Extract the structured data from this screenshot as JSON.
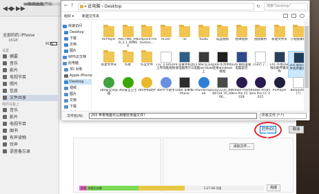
{
  "itunes": {
    "window_title": "单击此处开始",
    "device_name": "全部的的 iPhone",
    "device_capacity": "16GB",
    "battery": "91%",
    "settings_section": "设置",
    "sidebar_settings": [
      "摘要",
      "音乐",
      "影片",
      "电视节目",
      "照片",
      "信息",
      "文件共享"
    ],
    "on_device_section": "我的设备上",
    "sidebar_device": [
      "音乐",
      "影片",
      "电视节目",
      "图书",
      "有声读物",
      "铃声",
      "语音备忘录"
    ],
    "add_file_label": "添加文件...",
    "capacity_segments": [
      {
        "label": "音频",
        "color": "#e86ac6",
        "fraction": 0.04
      },
      {
        "label": "其他与文稿",
        "color": "#7ed957",
        "fraction": 0.28
      },
      {
        "label": "",
        "color": "#e8c744",
        "fraction": 0.25
      },
      {
        "label": "",
        "color": "#efefef",
        "fraction": 0.43
      }
    ],
    "free_label": "5.27 GB 可用",
    "sync_label": "完成"
  },
  "dialog": {
    "breadcrumb": "« 此电脑 › Desktop",
    "search_placeholder": "搜索\"Desktop\"",
    "organize_label": "组织 ▾",
    "new_folder_label": "新建文件夹",
    "tree": [
      {
        "label": "快速访问",
        "color": "#3a86d4"
      },
      {
        "label": "Desktop",
        "color": "#3a86d4"
      },
      {
        "label": "下载",
        "color": "#3a86d4"
      },
      {
        "label": "文档",
        "color": "#3a86d4"
      },
      {
        "label": "图片",
        "color": "#3a86d4"
      },
      {
        "label": "WPS云文档",
        "color": "#4b8be0"
      },
      {
        "label": "此电脑",
        "color": "#5a8fc7"
      },
      {
        "label": "3D 对象",
        "color": "#5a8fc7"
      },
      {
        "label": "Apple iPhone",
        "color": "#666666"
      },
      {
        "label": "Desktop",
        "color": "#3a86d4"
      },
      {
        "label": "视频",
        "color": "#5a8fc7"
      },
      {
        "label": "图片",
        "color": "#5a8fc7"
      },
      {
        "label": "文档",
        "color": "#5a8fc7"
      },
      {
        "label": "下载",
        "color": "#5a8fc7"
      },
      {
        "label": "音乐",
        "color": "#5a8fc7"
      }
    ],
    "items": [
      {
        "label": "AirPlayer",
        "kind": "folder",
        "color": "#f0c552"
      },
      {
        "label": "ARCTIME_PRO_2.1_WIN64",
        "kind": "folder",
        "color": "#f0c552"
      },
      {
        "label": "Endpoint Protection...",
        "kind": "folder",
        "color": "#f0c552"
      },
      {
        "label": "eCom",
        "kind": "folder",
        "color": "#f0c552"
      },
      {
        "label": "ioi",
        "kind": "folder",
        "color": "#f0c552"
      },
      {
        "label": "YouKu",
        "kind": "folder",
        "color": "#f0c552"
      },
      {
        "label": "成品视频",
        "kind": "folder",
        "color": "#f0c552"
      },
      {
        "label": "授课视频",
        "kind": "folder",
        "color": "#f0c552"
      },
      {
        "label": "视频素材",
        "kind": "folder",
        "color": "#f0c552"
      },
      {
        "label": "新建文件夹",
        "kind": "folder",
        "color": "#f0c552"
      },
      {
        "label": "小视频素材",
        "kind": "folder",
        "color": "#f0c552"
      },
      {
        "label": "新建文件夹",
        "kind": "folder",
        "color": "#f0c552"
      },
      {
        "label": "作者",
        "kind": "folder",
        "color": "#f0c552"
      },
      {
        "label": "作业文件",
        "kind": "folder",
        "color": "#f0c552"
      },
      {
        "label": "[入门] 6月29上传优酷视频",
        "kind": "file",
        "color": "#ffffff"
      },
      {
        "label": "6.苹果手机连接电脑用什么",
        "kind": "file",
        "color": "#2f5f86"
      },
      {
        "label": "15.Mac怎么在电脑windows上",
        "kind": "file",
        "color": "#3b3b3b"
      },
      {
        "label": "149-华为手机连接windows教程",
        "kind": "file",
        "color": "#1f1f1f"
      },
      {
        "label": "126.如何查看电脑是否",
        "kind": "file",
        "color": "#2e4a8c"
      },
      {
        "label": "150行了...",
        "kind": "file",
        "color": "#ffffff"
      },
      {
        "label": "141.不用USB线也能传输文件",
        "kind": "file",
        "color": "#2a3f5a"
      },
      {
        "label": "205.如何苹果手机传输文件",
        "kind": "file",
        "color": "#1e3b5a",
        "selected": true
      },
      {
        "label": "360安全浏览器",
        "kind": "app",
        "color": "#3fa33f"
      },
      {
        "label": "360安全卫士",
        "kind": "app",
        "color": "#38a800"
      },
      {
        "label": "360手机助手",
        "kind": "app",
        "color": "#e8b92a"
      },
      {
        "label": "360卡卡助手",
        "kind": "app",
        "color": "#6a8fe0"
      },
      {
        "label": "1066 苹果和iPhone",
        "kind": "file",
        "color": "#2e2e2e"
      },
      {
        "label": "ThunderSpeed",
        "kind": "app",
        "color": "#2f7fd4"
      },
      {
        "label": "1021235_8466724 70_0006...",
        "kind": "file",
        "color": "#4a4a4a"
      },
      {
        "label": "Adobe Premiere Pro CC 2018",
        "kind": "app",
        "color": "#2b1a4f"
      },
      {
        "label": "Adobe Premiere Pro CC 2015",
        "kind": "app",
        "color": "#2b1a4f"
      },
      {
        "label": "AirPlayer",
        "kind": "app",
        "color": "#1f1f3f"
      },
      {
        "label": "Bonjour64 (?)",
        "kind": "file",
        "color": "#ffffff"
      }
    ],
    "filename_label": "文件名(N):",
    "filename_value": "205 苹果电脑可以用哪些传输文件？",
    "filetype_value": "所有文件 (*.*)",
    "open_label": "打开(O)",
    "cancel_label": "取消"
  },
  "colors": {
    "highlight_circle": "#e0202a",
    "selection": "#cce8ff",
    "open_border": "#0078d7"
  }
}
